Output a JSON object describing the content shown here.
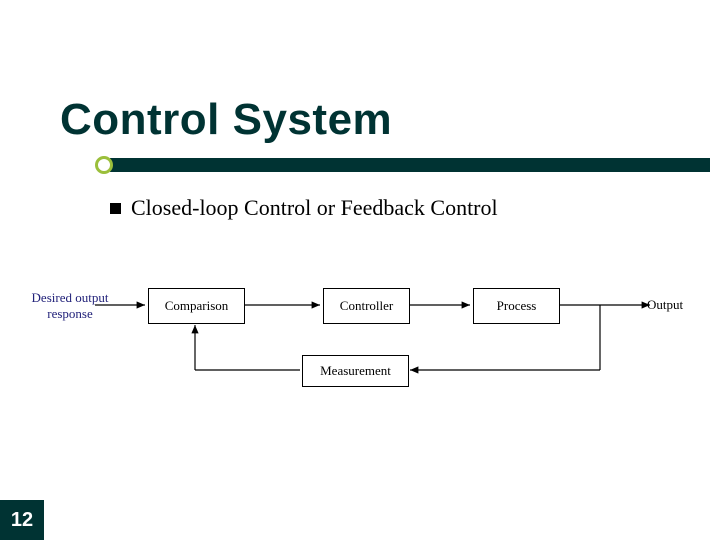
{
  "title": "Control System",
  "bullet": "Closed-loop Control or Feedback Control",
  "diagram": {
    "input_label": "Desired output\nresponse",
    "box_comparison": "Comparison",
    "box_controller": "Controller",
    "box_process": "Process",
    "box_measurement": "Measurement",
    "output_label": "Output"
  },
  "page_number": "12"
}
